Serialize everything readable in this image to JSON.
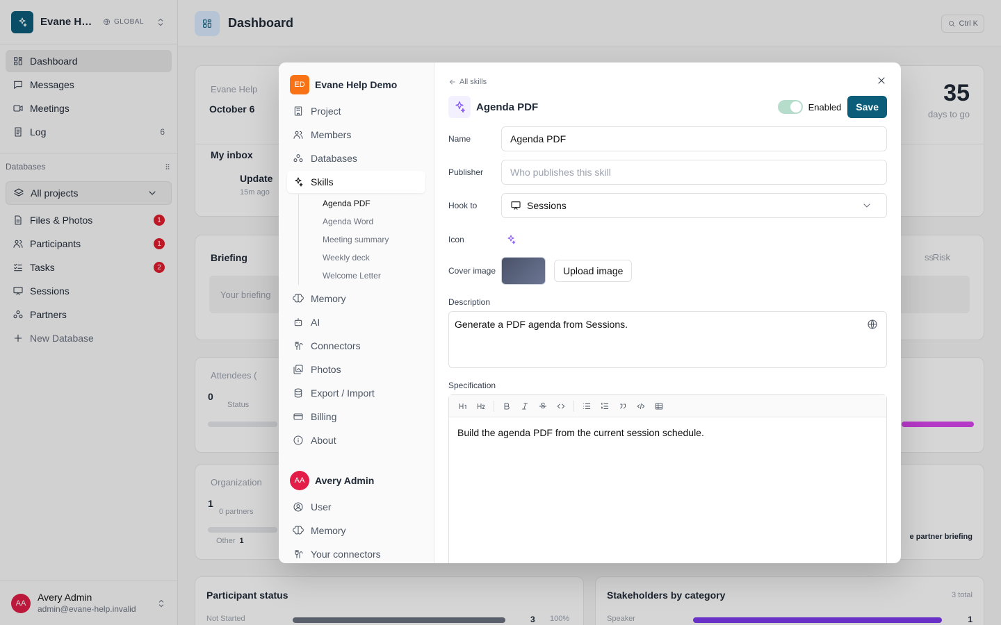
{
  "workspace": {
    "name": "Evane Help Demo",
    "scope": "GLOBAL"
  },
  "nav": [
    {
      "label": "Dashboard",
      "icon": "grid-icon",
      "active": true
    },
    {
      "label": "Messages",
      "icon": "message-icon"
    },
    {
      "label": "Meetings",
      "icon": "video-icon"
    },
    {
      "label": "Log",
      "icon": "log-icon",
      "count": "6"
    }
  ],
  "databases": {
    "heading": "Databases",
    "selector": "All projects",
    "items": [
      {
        "label": "Files & Photos",
        "badge": "1"
      },
      {
        "label": "Participants",
        "badge": "1"
      },
      {
        "label": "Tasks",
        "badge": "2"
      },
      {
        "label": "Sessions"
      },
      {
        "label": "Partners"
      }
    ],
    "new_label": "New Database"
  },
  "user": {
    "initials": "AA",
    "name": "Avery Admin",
    "email": "admin@evane-help.invalid"
  },
  "topbar": {
    "title": "Dashboard",
    "shortcut": "Ctrl K"
  },
  "background": {
    "hero_label": "Evane Help",
    "hero_date": "October 6",
    "days_count": "35",
    "days_label": "days to go",
    "inbox_title": "My inbox",
    "inbox_item": "Update",
    "inbox_time": "15m ago",
    "briefing_title": "Briefing",
    "briefing_placeholder": "Your briefing",
    "briefing_tabs": [
      "ss",
      "Risk"
    ],
    "attendees_title": "Attendees (",
    "attendees_count": "0",
    "attendees_status": "Status",
    "org_title": "Organization",
    "org_count": "1",
    "org_sub": "0 partners",
    "org_other": "Other",
    "org_other_count": "1",
    "partner_briefing": "e partner briefing",
    "participant_status_title": "Participant status",
    "participant_row_label": "Not Started",
    "participant_row_count": "3",
    "participant_row_pct": "100%",
    "stakeholders_title": "Stakeholders by category",
    "stakeholders_total": "3 total",
    "stakeholder_row_label": "Speaker",
    "stakeholder_row_count": "1"
  },
  "modal": {
    "org": {
      "initials": "ED",
      "name": "Evane Help Demo"
    },
    "settings_nav": [
      {
        "label": "Project"
      },
      {
        "label": "Members"
      },
      {
        "label": "Databases"
      },
      {
        "label": "Skills",
        "active": true
      }
    ],
    "skills": [
      "Agenda PDF",
      "Agenda Word",
      "Meeting summary",
      "Weekly deck",
      "Welcome Letter"
    ],
    "settings_nav2": [
      {
        "label": "Memory"
      },
      {
        "label": "AI"
      },
      {
        "label": "Connectors"
      },
      {
        "label": "Photos"
      },
      {
        "label": "Export / Import"
      },
      {
        "label": "Billing"
      },
      {
        "label": "About"
      }
    ],
    "user_section": {
      "initials": "AA",
      "name": "Avery Admin"
    },
    "user_nav": [
      {
        "label": "User"
      },
      {
        "label": "Memory"
      },
      {
        "label": "Your connectors"
      }
    ],
    "back_label": "All skills",
    "skill": {
      "title": "Agenda PDF",
      "enabled_label": "Enabled",
      "save_label": "Save",
      "name_label": "Name",
      "name_value": "Agenda PDF",
      "publisher_label": "Publisher",
      "publisher_placeholder": "Who publishes this skill",
      "hook_label": "Hook to",
      "hook_value": "Sessions",
      "icon_label": "Icon",
      "cover_label": "Cover image",
      "upload_label": "Upload image",
      "description_label": "Description",
      "description_value": "Generate a PDF agenda from Sessions.",
      "spec_label": "Specification",
      "spec_value": "Build the agenda PDF from the current session schedule."
    }
  },
  "colors": {
    "brand": "#0b5d7a",
    "badge": "#e11d2e",
    "avatar": "#e11d48",
    "org": "#f97316",
    "skill": "#8b5cf6"
  }
}
